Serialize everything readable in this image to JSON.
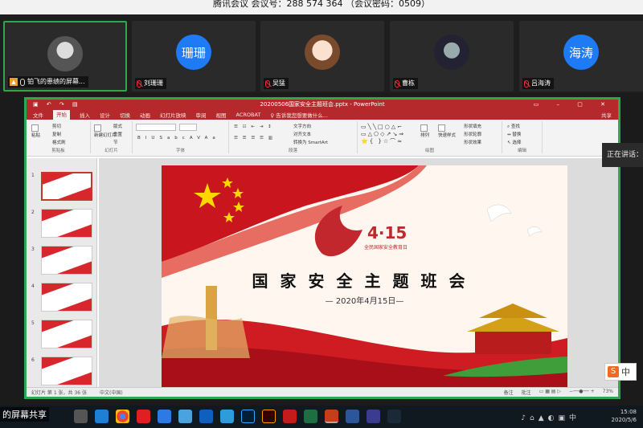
{
  "meeting": {
    "title": "腾讯会议 会议号：288 574 364 （会议密码：0509）"
  },
  "participants": [
    {
      "name": "铂飞的患绩的屏幕...",
      "avatar_text": "",
      "muted": false,
      "active": true
    },
    {
      "name": "刘珊珊",
      "avatar_text": "珊珊",
      "muted": true,
      "active": false
    },
    {
      "name": "吴猛",
      "avatar_text": "",
      "muted": true,
      "active": false
    },
    {
      "name": "曹栋",
      "avatar_text": "",
      "muted": true,
      "active": false
    },
    {
      "name": "吕海涛",
      "avatar_text": "海涛",
      "muted": true,
      "active": false
    }
  ],
  "ppt": {
    "window_title": "20200506国家安全主题班会.pptx - PowerPoint",
    "tabs": [
      "文件",
      "开始",
      "插入",
      "设计",
      "切换",
      "动画",
      "幻灯片放映",
      "审阅",
      "视图",
      "ACROBAT",
      "♀ 告诉我您想要做什么..."
    ],
    "share_label": "共享",
    "ribbon": {
      "clipboard": {
        "label": "剪贴板",
        "paste": "粘贴",
        "cut": "剪切",
        "copy": "复制",
        "format": "格式刷"
      },
      "slides": {
        "label": "幻灯片",
        "new": "新建幻灯片",
        "layout": "版式",
        "reset": "重置",
        "section": "节"
      },
      "font": {
        "label": "字体",
        "bold": "B",
        "italic": "I",
        "underline": "U",
        "strike": "S",
        "shadow": "abc",
        "spacing": "AV",
        "case": "Aa"
      },
      "paragraph": {
        "label": "段落",
        "direction": "文字方向",
        "align": "对齐文本",
        "smartart": "转换为 SmartArt"
      },
      "drawing": {
        "label": "绘图",
        "arrange": "排列",
        "quick": "快速样式",
        "fill": "形状填充",
        "outline": "形状轮廓",
        "effect": "形状效果"
      },
      "editing": {
        "label": "编辑",
        "find": "查找",
        "replace": "替换",
        "select": "选择"
      }
    },
    "slide_numbers": [
      "1",
      "2",
      "3",
      "4",
      "5",
      "6"
    ],
    "slide": {
      "title": "国家安全主题班会",
      "date": "— 2020年4月15日—",
      "emblem_number": "4·15",
      "emblem_subtitle": "全民国家安全教育日"
    },
    "status": {
      "slide": "幻灯片 第 1 张，共 36 张",
      "lang": "中文(中国)",
      "notes": "备注",
      "comments": "批注",
      "zoom": "73%"
    }
  },
  "overlay": {
    "speaking": "正在讲话：",
    "ime": "中",
    "share_label": "的屏幕共享"
  },
  "taskbar": {
    "time": "15:08",
    "date": "2020/5/6"
  },
  "colors": {
    "accent": "#2ea84d",
    "ppt_red": "#b5282c",
    "avatar_blue": "#1f7af6"
  }
}
